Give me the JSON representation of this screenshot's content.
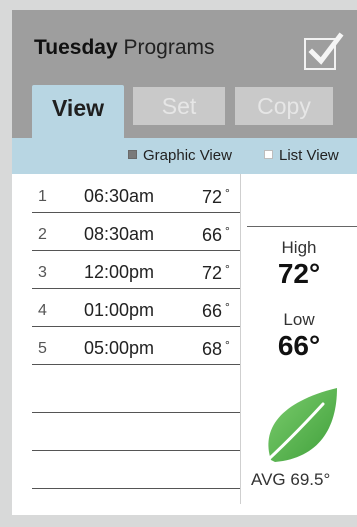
{
  "header": {
    "day": "Tuesday",
    "title_suffix": "Programs"
  },
  "tabs": [
    {
      "label": "View",
      "active": true
    },
    {
      "label": "Set",
      "active": false
    },
    {
      "label": "Copy",
      "active": false
    }
  ],
  "view_options": {
    "graphic": {
      "label": "Graphic View",
      "selected": true
    },
    "list": {
      "label": "List View",
      "selected": false
    }
  },
  "programs": [
    {
      "num": "1",
      "time": "06:30am",
      "temp": "72",
      "unit": "°"
    },
    {
      "num": "2",
      "time": "08:30am",
      "temp": "66",
      "unit": "°"
    },
    {
      "num": "3",
      "time": "12:00pm",
      "temp": "72",
      "unit": "°"
    },
    {
      "num": "4",
      "time": "01:00pm",
      "temp": "66",
      "unit": "°"
    },
    {
      "num": "5",
      "time": "05:00pm",
      "temp": "68",
      "unit": "°"
    }
  ],
  "summary": {
    "high_label": "High",
    "high_value": "72°",
    "low_label": "Low",
    "low_value": "66°",
    "avg": "AVG 69.5°"
  },
  "colors": {
    "header_bg": "#9e9e9e",
    "accent_blue": "#b8d6e3",
    "leaf_green": "#5cb85c"
  },
  "icons": {
    "checkbox": "check-icon",
    "leaf": "leaf-icon"
  }
}
